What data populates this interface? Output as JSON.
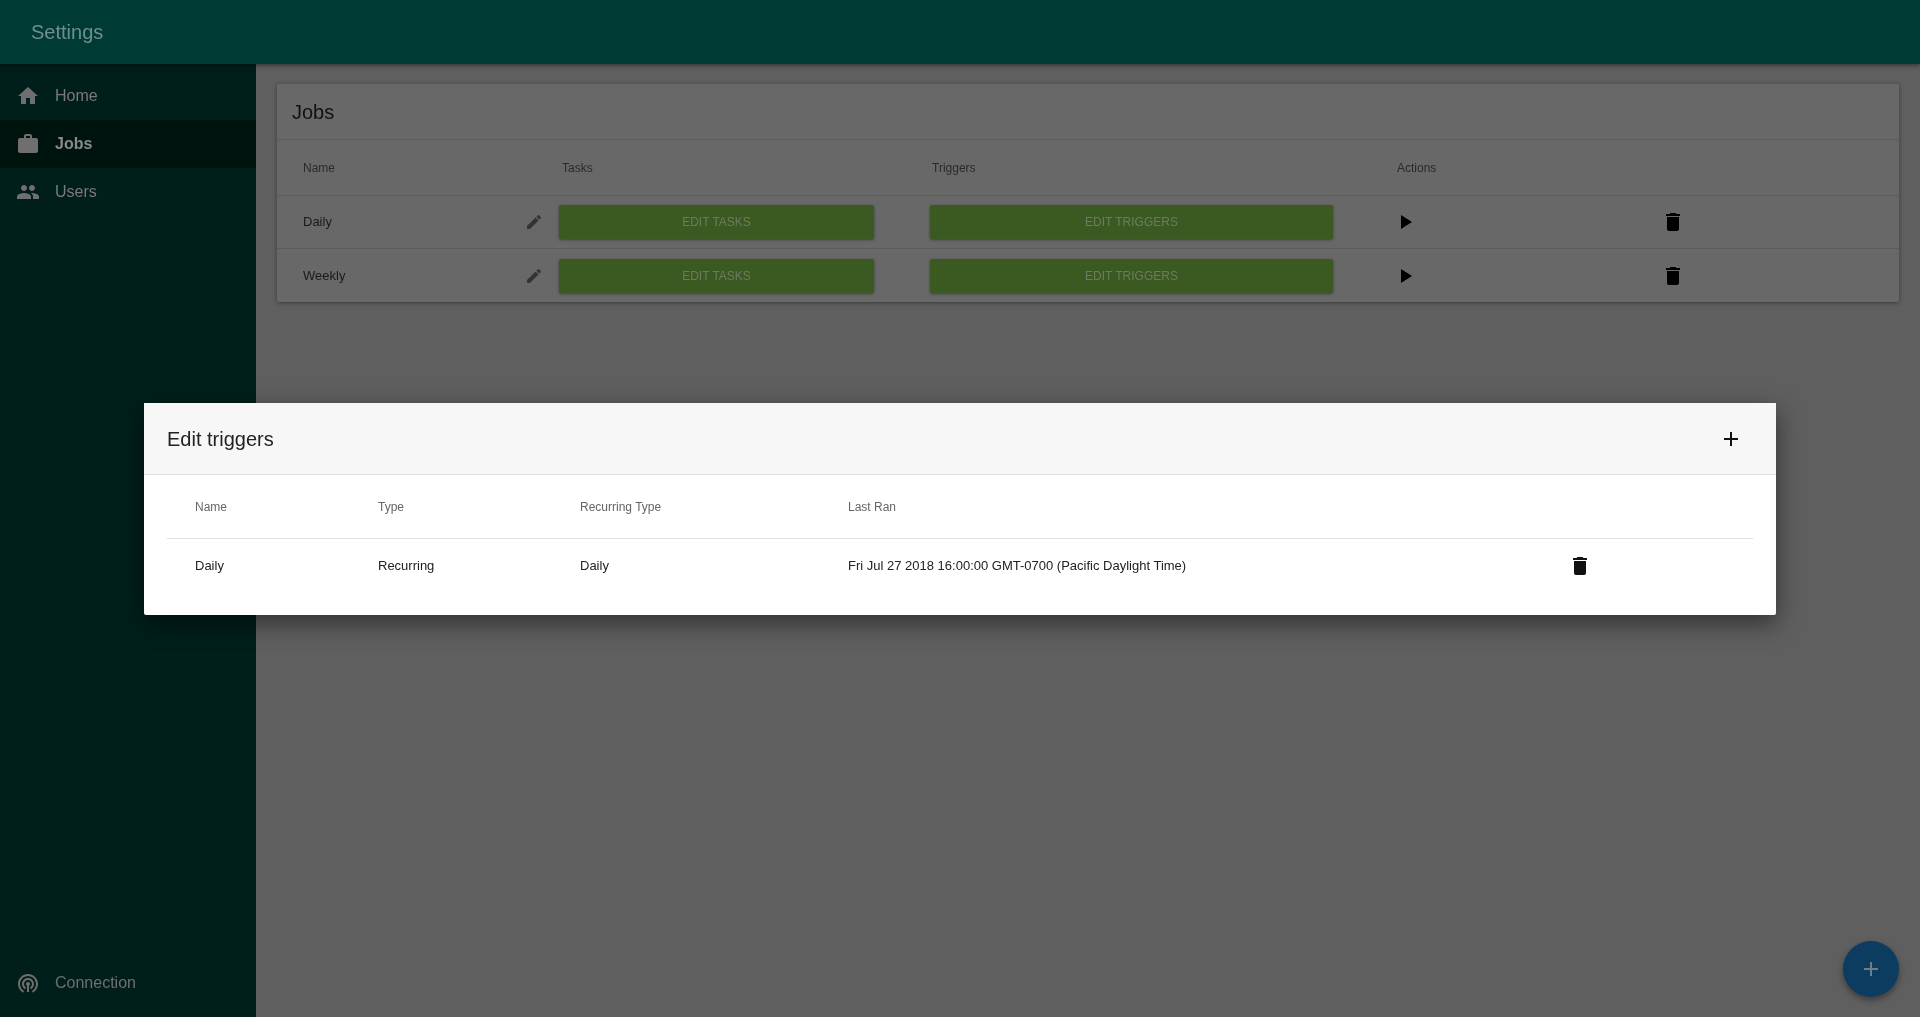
{
  "app_bar": {
    "title": "Settings"
  },
  "sidebar": {
    "items": [
      {
        "label": "Home",
        "selected": false
      },
      {
        "label": "Jobs",
        "selected": true
      },
      {
        "label": "Users",
        "selected": false
      }
    ],
    "footer_item": {
      "label": "Connection"
    }
  },
  "jobs": {
    "title": "Jobs",
    "columns": [
      "Name",
      "Tasks",
      "Triggers",
      "Actions"
    ],
    "rows": [
      {
        "name": "Daily",
        "tasks_button": "EDIT TASKS",
        "triggers_button": "EDIT TRIGGERS"
      },
      {
        "name": "Weekly",
        "tasks_button": "EDIT TASKS",
        "triggers_button": "EDIT TRIGGERS"
      }
    ]
  },
  "dialog": {
    "title": "Edit triggers",
    "columns": [
      "Name",
      "Type",
      "Recurring Type",
      "Last Ran"
    ],
    "rows": [
      {
        "name": "Daily",
        "type": "Recurring",
        "recurring_type": "Daily",
        "last_ran": "Fri Jul 27 2018 16:00:00 GMT-0700 (Pacific Daylight Time)"
      }
    ]
  }
}
